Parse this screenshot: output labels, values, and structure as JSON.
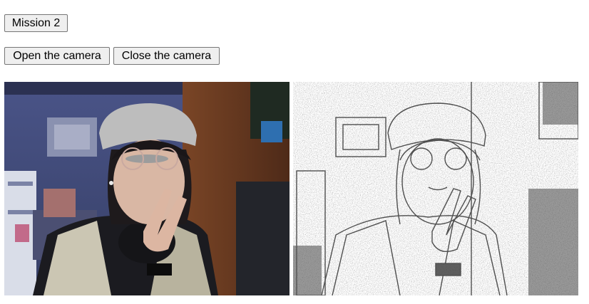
{
  "controls": {
    "mission_label": "Mission 2",
    "open_camera_label": "Open the camera",
    "close_camera_label": "Close the camera"
  },
  "colors": {
    "video_wall": "#3f4a73",
    "video_door": "#6b3b22",
    "canvas_bg": "#ffffff",
    "sketch_stroke": "#333333"
  }
}
